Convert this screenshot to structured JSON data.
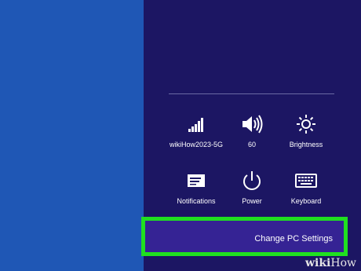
{
  "charm": {
    "row1": [
      {
        "label": "wikiHow2023-5G",
        "icon": "wifi-signal-icon"
      },
      {
        "label": "60",
        "icon": "volume-icon"
      },
      {
        "label": "Brightness",
        "icon": "brightness-icon"
      }
    ],
    "row2": [
      {
        "label": "Notifications",
        "icon": "notifications-icon"
      },
      {
        "label": "Power",
        "icon": "power-icon"
      },
      {
        "label": "Keyboard",
        "icon": "keyboard-icon"
      }
    ],
    "change_label": "Change PC Settings"
  },
  "watermark": {
    "wiki": "wiki",
    "how": "How"
  },
  "colors": {
    "left_panel": "#1f57b5",
    "charm_background": "#1c1663",
    "button_background": "#352394",
    "highlight": "#20e020"
  }
}
